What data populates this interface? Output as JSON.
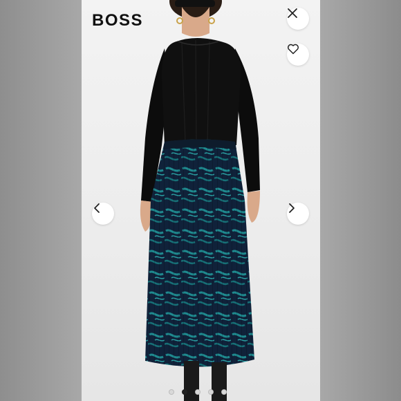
{
  "brand": {
    "name": "BOSS"
  },
  "controls": {
    "close_icon": "close-icon",
    "favorite_icon": "heart-outline-icon",
    "prev_icon": "chevron-left-icon",
    "next_icon": "chevron-right-icon"
  },
  "carousel": {
    "total_images": 5,
    "active_index": 1
  },
  "colors": {
    "top": "#0d0d0d",
    "skirt_base": "#102238",
    "skirt_pattern": "#1e7f86",
    "background": "#f0f0f0"
  }
}
